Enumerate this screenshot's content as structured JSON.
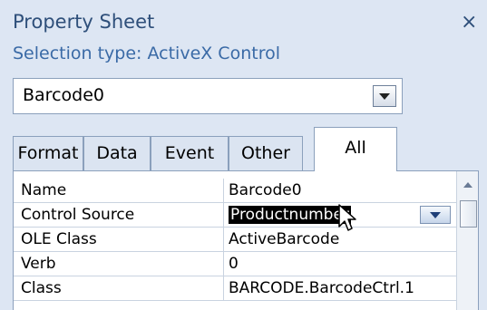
{
  "panel": {
    "title": "Property Sheet",
    "close_glyph": "×",
    "selection_type": "Selection type:  ActiveX Control"
  },
  "object_select": {
    "value": "Barcode0"
  },
  "tabs": [
    {
      "label": "Format"
    },
    {
      "label": "Data"
    },
    {
      "label": "Event"
    },
    {
      "label": "Other"
    },
    {
      "label": "All",
      "active": true
    }
  ],
  "properties": [
    {
      "name": "Name",
      "value": "Barcode0"
    },
    {
      "name": "Control Source",
      "value": "Productnumber",
      "selected": true
    },
    {
      "name": "OLE Class",
      "value": "ActiveBarcode"
    },
    {
      "name": "Verb",
      "value": "0"
    },
    {
      "name": "Class",
      "value": "BARCODE.BarcodeCtrl.1"
    }
  ],
  "icons": {
    "close": "close-icon",
    "dropdown": "chevron-down-icon",
    "scroll_up": "scroll-up-icon",
    "cursor": "mouse-pointer-icon"
  },
  "colors": {
    "pane_bg": "#dde6f3",
    "title_text": "#2e4f7a",
    "selection_text": "#3a6aa6",
    "highlight_bg": "#000000",
    "highlight_text": "#ffffff"
  }
}
